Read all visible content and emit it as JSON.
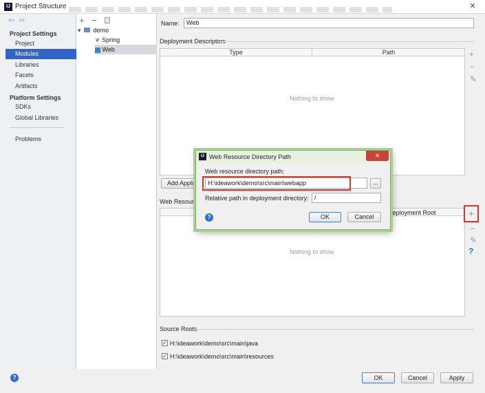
{
  "window": {
    "title": "Project Structure",
    "app_icon": "intellij-icon"
  },
  "left_nav": {
    "project_settings_heading": "Project Settings",
    "project_settings_items": [
      "Project",
      "Modules",
      "Libraries",
      "Facets",
      "Artifacts"
    ],
    "platform_settings_heading": "Platform Settings",
    "platform_settings_items": [
      "SDKs",
      "Global Libraries"
    ],
    "problems": "Problems",
    "selected": "Modules"
  },
  "module_tree": {
    "root": "demo",
    "children": [
      "Spring",
      "Web"
    ],
    "selected": "Web"
  },
  "main": {
    "name_label": "Name:",
    "name_value": "Web",
    "deployment_descriptors_title": "Deployment Descriptors",
    "dd_columns": [
      "Type",
      "Path"
    ],
    "dd_empty": "Nothing to show",
    "add_app_button": "Add Appli",
    "web_resource_title": "Web Resource",
    "wr_column_deploy_root": "Deployment Root",
    "wr_empty": "Nothing to show",
    "source_roots_title": "Source Roots",
    "source_roots": [
      {
        "path": "H:\\ideawork\\demo\\src\\main\\java",
        "checked": true
      },
      {
        "path": "H:\\ideawork\\demo\\src\\main\\resources",
        "checked": true
      }
    ]
  },
  "dialog": {
    "title": "Web Resource Directory Path",
    "path_label": "Web resource directory path:",
    "path_value": "H:\\ideawork\\demo\\src\\main\\webapp",
    "browse_label": "...",
    "relative_label": "Relative path in deployment directory:",
    "relative_value": "/",
    "ok": "OK",
    "cancel": "Cancel",
    "close": "✕"
  },
  "footer": {
    "ok": "OK",
    "cancel": "Cancel",
    "apply": "Apply"
  },
  "colors": {
    "selection": "#2f65ca",
    "highlight_red": "#d5342f",
    "add_green": "#3a9a3a"
  }
}
